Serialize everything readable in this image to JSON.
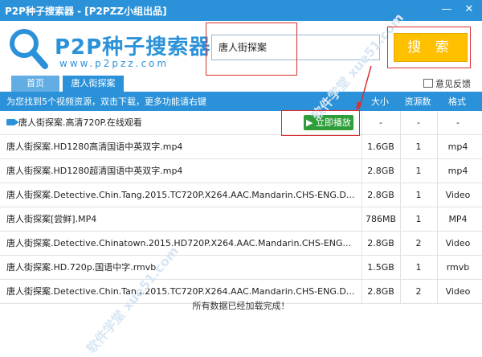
{
  "window": {
    "title": "P2P种子搜索器 - [P2PZZ小组出品]",
    "minimize": "—",
    "close": "✕"
  },
  "logo": {
    "name": "P2P种子搜索器",
    "url": "www.p2pzz.com"
  },
  "search": {
    "value": "唐人街探案",
    "button_label": "搜 索"
  },
  "tabs": [
    {
      "label": "首页"
    },
    {
      "label": "唐人街探案"
    }
  ],
  "feedback_label": "意见反馈",
  "info": {
    "hint": "为您找到5个视频资源，双击下载，更多功能请右键",
    "col_size": "大小",
    "col_count": "资源数",
    "col_format": "格式"
  },
  "play_label": "立即播放",
  "rows": [
    {
      "name": "唐人街探案.高清720P.在线观看",
      "size": "-",
      "count": "-",
      "format": "-"
    },
    {
      "name": "唐人街探案.HD1280高清国语中英双字.mp4",
      "size": "1.6GB",
      "count": "1",
      "format": "mp4"
    },
    {
      "name": "唐人街探案.HD1280超清国语中英双字.mp4",
      "size": "2.8GB",
      "count": "1",
      "format": "mp4"
    },
    {
      "name": "唐人街探案.Detective.Chin.Tang.2015.TC720P.X264.AAC.Mandarin.CHS-ENG.D...",
      "size": "2.8GB",
      "count": "1",
      "format": "Video"
    },
    {
      "name": "唐人街探案[尝鲜].MP4",
      "size": "786MB",
      "count": "1",
      "format": "MP4"
    },
    {
      "name": "唐人街探案.Detective.Chinatown.2015.HD720P.X264.AAC.Mandarin.CHS-ENG...",
      "size": "2.8GB",
      "count": "2",
      "format": "Video"
    },
    {
      "name": "唐人街探案.HD.720p.国语中字.rmvb",
      "size": "1.5GB",
      "count": "1",
      "format": "rmvb"
    },
    {
      "name": "唐人街探案.Detective.Chin.Tang.2015.TC720P.X264.AAC.Mandarin.CHS-ENG.D...",
      "size": "2.8GB",
      "count": "2",
      "format": "Video"
    }
  ],
  "footer": "所有数据已经加载完成！",
  "watermark": "软件学堂 xue51.com",
  "colors": {
    "accent": "#2b92d9",
    "search_button": "#ffc000",
    "play": "#2e9e3a",
    "annotation": "#d93030"
  }
}
